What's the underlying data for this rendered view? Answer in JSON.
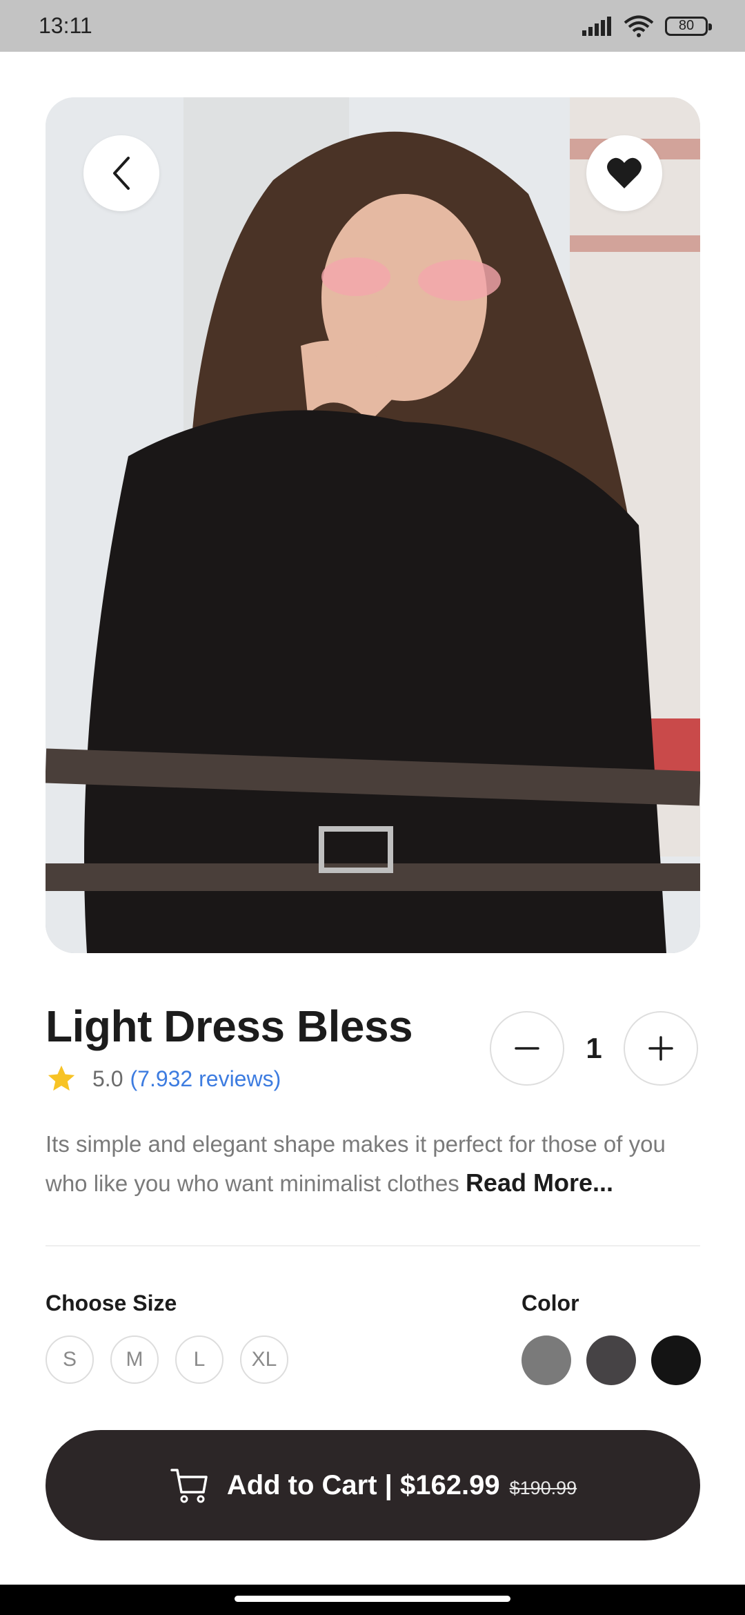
{
  "status": {
    "time": "13:11",
    "battery": "80",
    "icons": [
      "signal-icon",
      "wifi-icon",
      "battery-icon"
    ]
  },
  "hero": {
    "image_description_icon": "product-photo",
    "back_icon": "chevron-left-icon",
    "favorite_icon": "heart-icon"
  },
  "product": {
    "title": "Light Dress Bless",
    "rating": "5.0",
    "reviews": "(7.932 reviews)",
    "quantity": "1",
    "description": "Its simple and elegant shape makes it perfect for those of you who like you who want minimalist clothes",
    "read_more": "Read More..."
  },
  "options": {
    "size_label": "Choose Size",
    "sizes": [
      "S",
      "M",
      "L",
      "XL"
    ],
    "color_label": "Color",
    "colors": [
      "#7a7a7a",
      "#464345",
      "#141414"
    ]
  },
  "cart": {
    "label": "Add to Cart | $162.99",
    "old_price": "$190.99",
    "icon": "cart-icon"
  },
  "theme": {
    "accent_dark": "#2c2627",
    "link_blue": "#3d7ce0",
    "star_yellow": "#f7c325"
  }
}
